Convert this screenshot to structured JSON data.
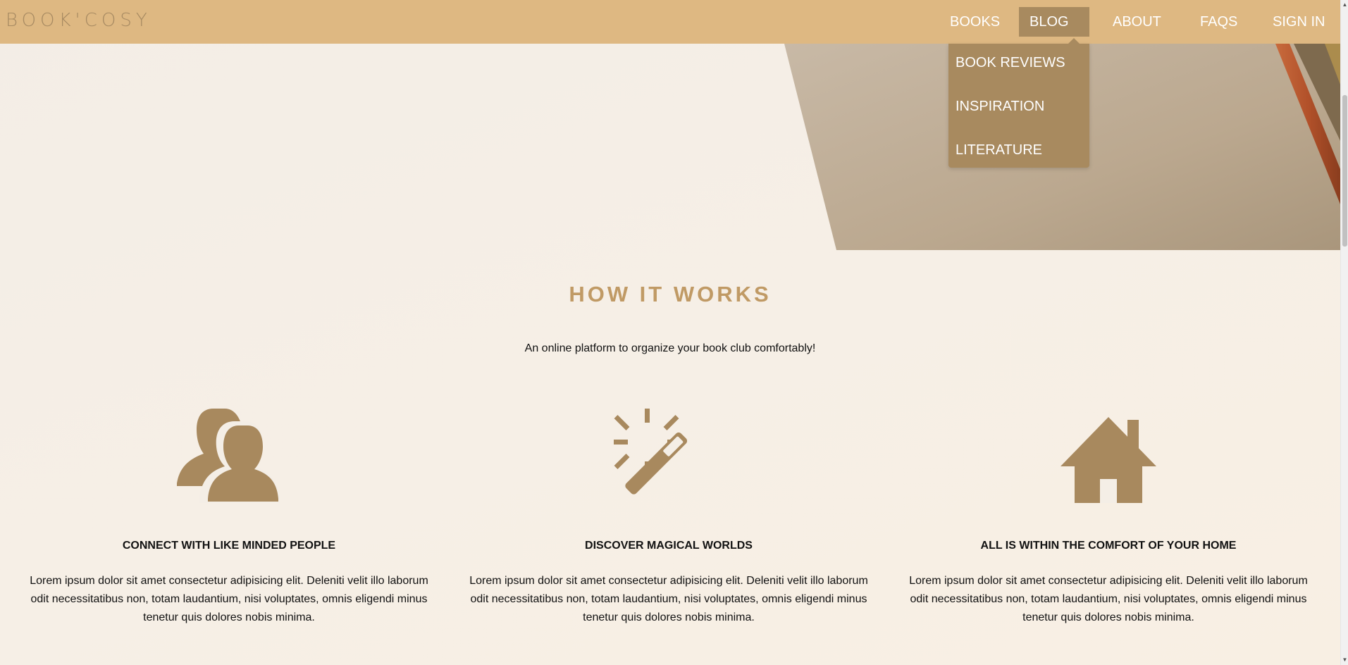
{
  "brand": "BOOK'COSY",
  "nav": {
    "books": "BOOKS",
    "blog": "BLOG",
    "about": "ABOUT",
    "faqs": "FAQS",
    "signin": "SIGN IN"
  },
  "blog_dropdown": {
    "items": [
      "BOOK REVIEWS",
      "INSPIRATION",
      "LITERATURE"
    ]
  },
  "how_it_works": {
    "title": "HOW IT WORKS",
    "subtitle": "An online platform to organize your book club comfortably!",
    "features": [
      {
        "icon": "users-icon",
        "title": "CONNECT WITH LIKE MINDED PEOPLE",
        "text": "Lorem ipsum dolor sit amet consectetur adipisicing elit. Deleniti velit illo laborum odit necessitatibus non, totam laudantium, nisi voluptates, omnis eligendi minus tenetur quis dolores nobis minima."
      },
      {
        "icon": "magic-wand-icon",
        "title": "DISCOVER MAGICAL WORLDS",
        "text": "Lorem ipsum dolor sit amet consectetur adipisicing elit. Deleniti velit illo laborum odit necessitatibus non, totam laudantium, nisi voluptates, omnis eligendi minus tenetur quis dolores nobis minima."
      },
      {
        "icon": "home-icon",
        "title": "ALL IS WITHIN THE COMFORT OF YOUR HOME",
        "text": "Lorem ipsum dolor sit amet consectetur adipisicing elit. Deleniti velit illo laborum odit necessitatibus non, totam laudantium, nisi voluptates, omnis eligendi minus tenetur quis dolores nobis minima."
      }
    ]
  },
  "colors": {
    "navbar": "#deb882",
    "accent": "#a88a5f",
    "title": "#c09a65"
  }
}
